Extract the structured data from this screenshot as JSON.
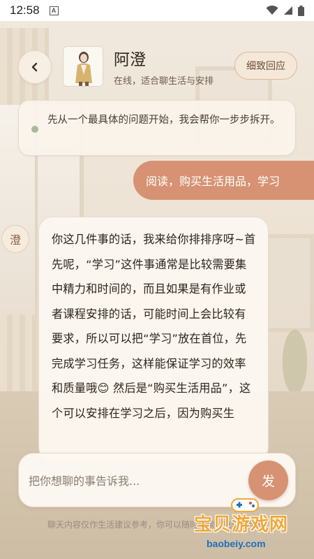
{
  "status_bar": {
    "time": "12:58",
    "notification_icon": "a-box-icon",
    "icons": [
      "wifi-icon",
      "signal-icon",
      "battery-icon"
    ]
  },
  "header": {
    "back_icon": "chevron-left-icon",
    "contact_name": "阿澄",
    "contact_status": "在线，适合聊生活与安排",
    "detail_button": "细致回应"
  },
  "hint": {
    "text": "先从一个最具体的问题开始，我会帮你一步步拆开。"
  },
  "messages": {
    "user_message": "阅读，购买生活用品，学习",
    "ai_avatar_label": "澄",
    "ai_reply": "你这几件事的话，我来给你排排序呀~首先呢，“学习”这件事通常是比较需要集中精力和时间的，而且如果是有作业或者课程安排的话，可能时间上会比较有要求，所以可以把“学习”放在首位，先完成学习任务，这样能保证学习的效率和质量哦😊 然后是“购买生活用品”，这个可以安排在学习之后，因为购买生"
  },
  "composer": {
    "placeholder": "把你想聊的事告诉我...",
    "send_label": "发"
  },
  "disclaimer": "聊天内容仅作生活建议参考，你可以随时继续补充你的场景。",
  "watermark": {
    "title": "宝贝游戏网",
    "url": "baobeiy.com"
  },
  "colors": {
    "accent": "#d69273",
    "status_dot": "#a9b89e",
    "background": "#efe6da"
  }
}
